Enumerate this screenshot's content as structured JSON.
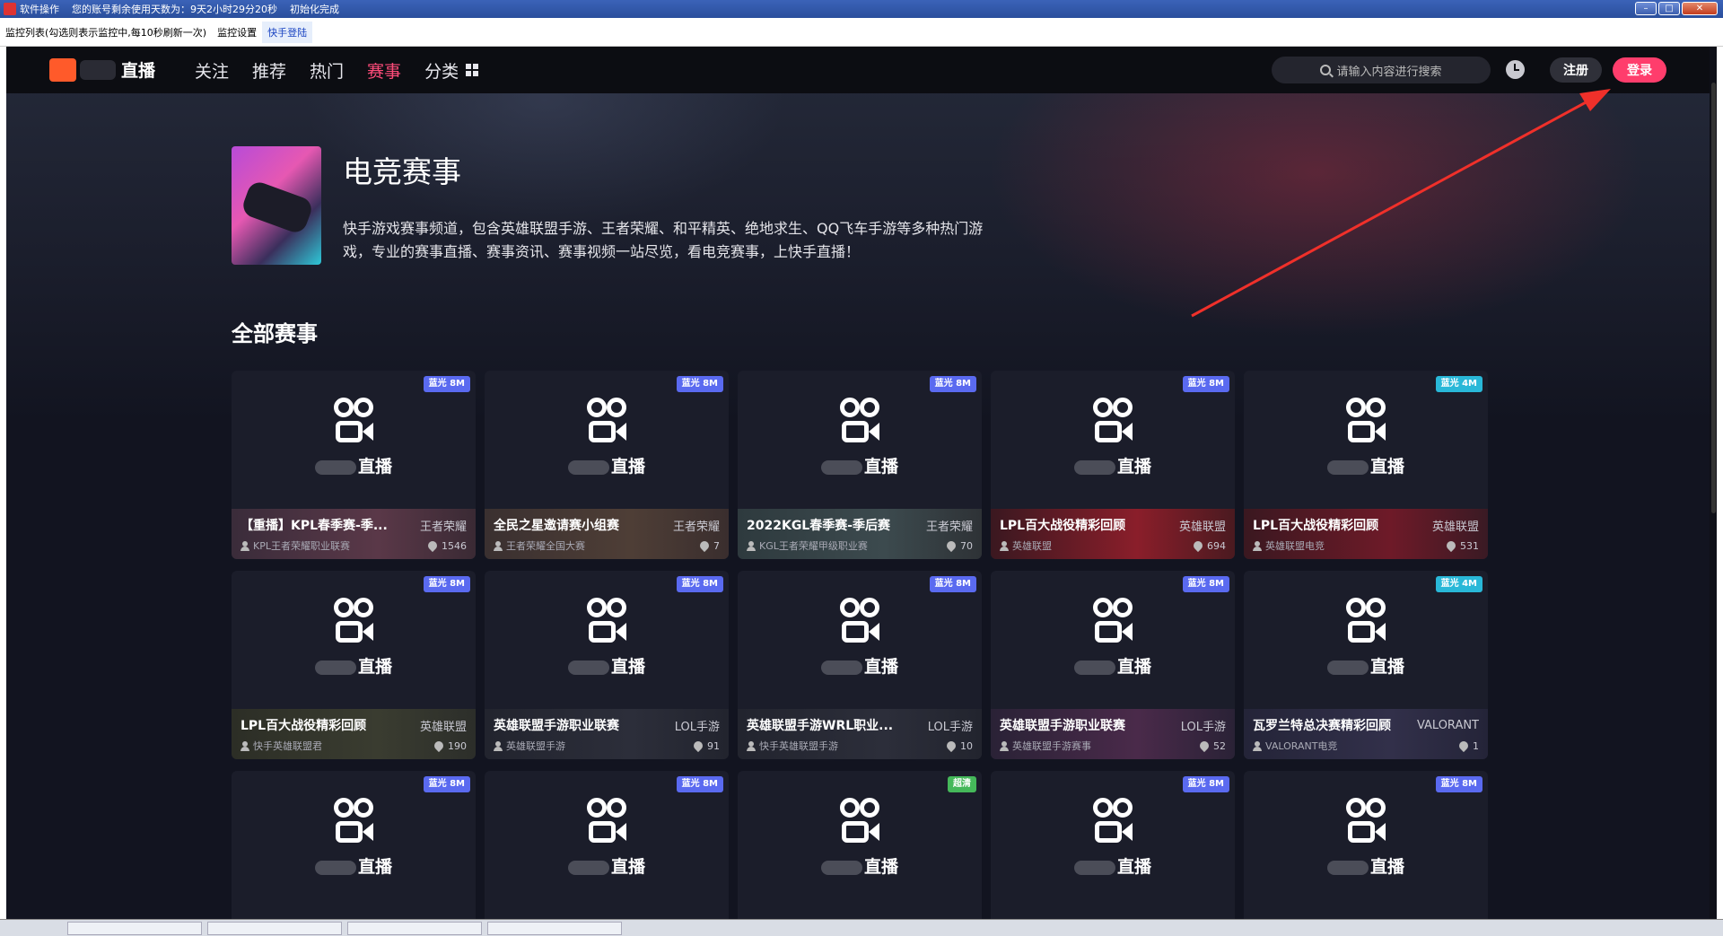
{
  "window": {
    "menu_label": "软件操作",
    "account_status": "您的账号剩余使用天数为：9天2小时29分20秒",
    "init_status": "初始化完成"
  },
  "toolbar": {
    "monitor_list": "监控列表(勾选则表示监控中,每10秒刷新一次)",
    "monitor_settings": "监控设置",
    "login_tab": "快手登陆"
  },
  "nav": {
    "logo_text": "直播",
    "links": [
      "关注",
      "推荐",
      "热门",
      "赛事",
      "分类"
    ],
    "active": "赛事",
    "search_placeholder": "请输入内容进行搜索",
    "register": "注册",
    "login": "登录"
  },
  "header": {
    "title": "电竞赛事",
    "description": "快手游戏赛事频道，包含英雄联盟手游、王者荣耀、和平精英、绝地求生、QQ飞车手游等多种热门游戏，专业的赛事直播、赛事资讯、赛事视频一站尽览，看电竞赛事，上快手直播！"
  },
  "section": {
    "title": "全部赛事"
  },
  "placeholder_brand": "直播",
  "colors": {
    "accent": "#ff3d6c",
    "nav_bg": "#0c0d12",
    "page_bg": "#121420",
    "badge_blue": "#5a6af0",
    "badge_cyan": "#29b8d8",
    "badge_green": "#45b85a"
  },
  "cards": [
    {
      "badge": "蓝光 8M",
      "badge_color": "blue",
      "title": "【重播】KPL春季赛-季...",
      "game": "王者荣耀",
      "anchor": "KPL王者荣耀职业联赛",
      "views": "1546",
      "bg": "pink"
    },
    {
      "badge": "蓝光 8M",
      "badge_color": "blue",
      "title": "全民之星邀请赛小组赛",
      "game": "王者荣耀",
      "anchor": "王者荣耀全国大赛",
      "views": "7",
      "bg": "brown"
    },
    {
      "badge": "蓝光 8M",
      "badge_color": "blue",
      "title": "2022KGL春季赛-季后赛",
      "game": "王者荣耀",
      "anchor": "KGL王者荣耀甲级职业赛",
      "views": "70",
      "bg": "teal"
    },
    {
      "badge": "蓝光 8M",
      "badge_color": "blue",
      "title": "LPL百大战役精彩回顾",
      "game": "英雄联盟",
      "anchor": "英雄联盟",
      "views": "694",
      "bg": "red"
    },
    {
      "badge": "蓝光 4M",
      "badge_color": "cyan",
      "title": "LPL百大战役精彩回顾",
      "game": "英雄联盟",
      "anchor": "英雄联盟电竞",
      "views": "531",
      "bg": "red2"
    },
    {
      "badge": "蓝光 8M",
      "badge_color": "blue",
      "title": "LPL百大战役精彩回顾",
      "game": "英雄联盟",
      "anchor": "快手英雄联盟君",
      "views": "190",
      "bg": "olive"
    },
    {
      "badge": "蓝光 8M",
      "badge_color": "blue",
      "title": "英雄联盟手游职业联赛",
      "game": "LOL手游",
      "anchor": "英雄联盟手游",
      "views": "91",
      "bg": "dark"
    },
    {
      "badge": "蓝光 8M",
      "badge_color": "blue",
      "title": "英雄联盟手游WRL职业...",
      "game": "LOL手游",
      "anchor": "快手英雄联盟手游",
      "views": "10",
      "bg": "dark"
    },
    {
      "badge": "蓝光 8M",
      "badge_color": "blue",
      "title": "英雄联盟手游职业联赛",
      "game": "LOL手游",
      "anchor": "英雄联盟手游赛事",
      "views": "52",
      "bg": "purple"
    },
    {
      "badge": "蓝光 4M",
      "badge_color": "cyan",
      "title": "瓦罗兰特总决赛精彩回顾",
      "game": "VALORANT",
      "anchor": "VALORANT电竞",
      "views": "1",
      "bg": "indigo"
    },
    {
      "badge": "蓝光 8M",
      "badge_color": "blue"
    },
    {
      "badge": "蓝光 8M",
      "badge_color": "blue"
    },
    {
      "badge": "超清",
      "badge_color": "green"
    },
    {
      "badge": "蓝光 8M",
      "badge_color": "blue"
    },
    {
      "badge": "蓝光 8M",
      "badge_color": "blue"
    }
  ]
}
